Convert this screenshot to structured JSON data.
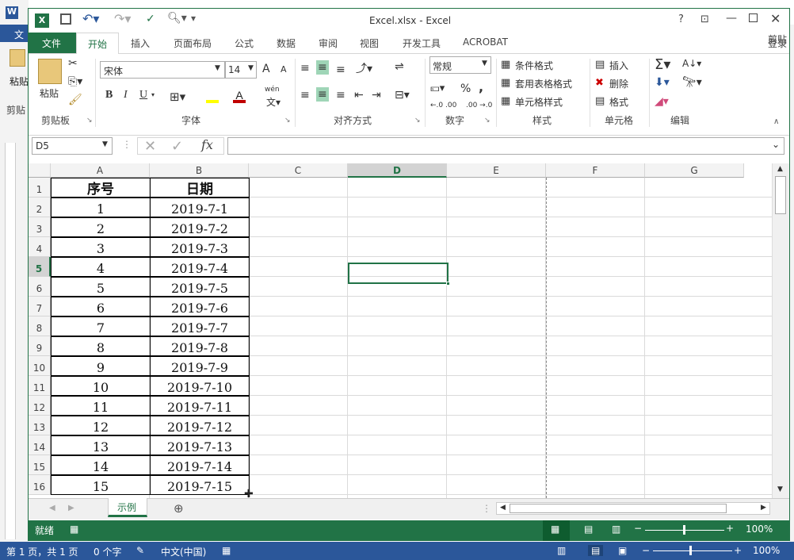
{
  "word": {
    "file_tab": "文",
    "partial_label1": "粘贴",
    "partial_label2": "剪贴",
    "login_partial": "录",
    "status": {
      "page": "第 1 页，共 1 页",
      "words": "0 个字",
      "lang": "中文(中国)",
      "zoom": "100%"
    }
  },
  "window": {
    "title": "Excel.xlsx - Excel",
    "login": "登录"
  },
  "tabs": [
    "文件",
    "开始",
    "插入",
    "页面布局",
    "公式",
    "数据",
    "审阅",
    "视图",
    "开发工具",
    "ACROBAT"
  ],
  "ribbon": {
    "clipboard": {
      "paste": "粘贴",
      "label": "剪贴板"
    },
    "font": {
      "name": "宋体",
      "size": "14",
      "bold": "B",
      "italic": "I",
      "underline": "U",
      "label": "字体",
      "grow": "A",
      "shrink": "A",
      "wen": "wén"
    },
    "alignment": {
      "label": "对齐方式"
    },
    "number": {
      "format": "常规",
      "percent": "%",
      "comma": ",",
      "label": "数字"
    },
    "styles": {
      "cond": "条件格式",
      "table": "套用表格格式",
      "cell": "单元格样式",
      "label": "样式"
    },
    "cells": {
      "insert": "插入",
      "delete": "删除",
      "format": "格式",
      "label": "单元格"
    },
    "editing": {
      "label": "编辑"
    }
  },
  "formula": {
    "namebox": "D5",
    "fx": "fx",
    "value": ""
  },
  "columns": [
    "A",
    "B",
    "C",
    "D",
    "E",
    "F",
    "G"
  ],
  "rows": [
    "1",
    "2",
    "3",
    "4",
    "5",
    "6",
    "7",
    "8",
    "9",
    "10",
    "11",
    "12",
    "13",
    "14",
    "15",
    "16"
  ],
  "table": {
    "headers": [
      "序号",
      "日期"
    ],
    "data": [
      [
        "1",
        "2019-7-1"
      ],
      [
        "2",
        "2019-7-2"
      ],
      [
        "3",
        "2019-7-3"
      ],
      [
        "4",
        "2019-7-4"
      ],
      [
        "5",
        "2019-7-5"
      ],
      [
        "6",
        "2019-7-6"
      ],
      [
        "7",
        "2019-7-7"
      ],
      [
        "8",
        "2019-7-8"
      ],
      [
        "9",
        "2019-7-9"
      ],
      [
        "10",
        "2019-7-10"
      ],
      [
        "11",
        "2019-7-11"
      ],
      [
        "12",
        "2019-7-12"
      ],
      [
        "13",
        "2019-7-13"
      ],
      [
        "14",
        "2019-7-14"
      ],
      [
        "15",
        "2019-7-15"
      ]
    ]
  },
  "sheet": {
    "name": "示例"
  },
  "status": {
    "ready": "就绪",
    "zoom": "100%"
  },
  "colors": {
    "excel_green": "#217346",
    "word_blue": "#2b579a"
  }
}
